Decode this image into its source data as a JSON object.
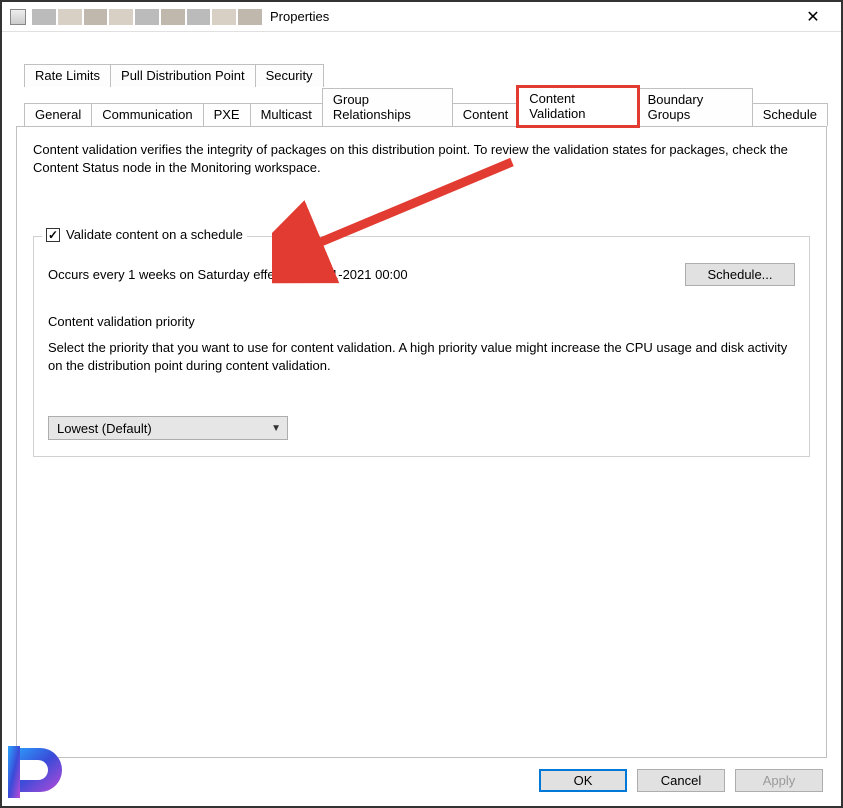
{
  "window": {
    "title": "Properties"
  },
  "tabs_row1": [
    "Rate Limits",
    "Pull Distribution Point",
    "Security"
  ],
  "tabs_row2": [
    "General",
    "Communication",
    "PXE",
    "Multicast",
    "Group Relationships",
    "Content",
    "Content Validation",
    "Boundary Groups",
    "Schedule"
  ],
  "active_tab": "Content Validation",
  "content": {
    "intro": "Content validation verifies the integrity of packages on this distribution point. To review the validation states for packages, check the Content Status node in the Monitoring workspace.",
    "checkbox_label": "Validate content on a schedule",
    "checkbox_checked": true,
    "schedule_text": "Occurs every 1 weeks on Saturday effective 19-01-2021 00:00",
    "schedule_button": "Schedule...",
    "priority_heading": "Content validation priority",
    "priority_text": "Select the priority that you want to use for content validation. A high priority value might increase the CPU usage and disk activity on the distribution point during content validation.",
    "priority_value": "Lowest (Default)"
  },
  "buttons": {
    "ok": "OK",
    "cancel": "Cancel",
    "apply": "Apply"
  },
  "annotation": {
    "arrow_color": "#e23b32"
  }
}
